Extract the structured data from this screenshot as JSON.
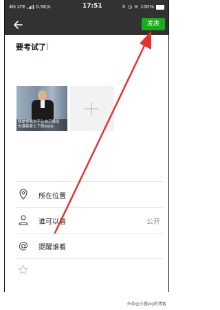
{
  "status_bar": {
    "network": "4G LTE",
    "speed": "0.5K/s",
    "time": "17:51",
    "battery": "100%"
  },
  "toolbar": {
    "publish_label": "发表"
  },
  "post": {
    "text": "要考试了"
  },
  "image": {
    "caption": "我是怪我也不让自己臭出\n去漂亮爱上了段6box"
  },
  "options": [
    {
      "label": "所在位置",
      "value": ""
    },
    {
      "label": "谁可以看",
      "value": "公开"
    },
    {
      "label": "提醒谁看",
      "value": ""
    }
  ],
  "watermark": "头条@小猪pig的博客",
  "colors": {
    "bar": "#323232",
    "accent": "#1AAD19",
    "arrow": "#E8312A"
  },
  "icons": [
    "back-icon",
    "plus-icon",
    "location-icon",
    "person-icon",
    "at-icon",
    "star-icon"
  ]
}
